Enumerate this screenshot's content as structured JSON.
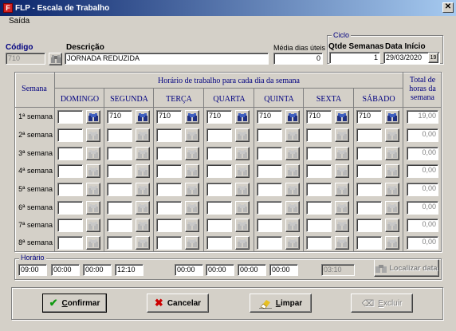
{
  "window": {
    "title": "FLP - Escala de Trabalho",
    "logo": "F",
    "close": "✕"
  },
  "menu": {
    "saida": "Saída"
  },
  "header": {
    "codigo_label": "Código",
    "codigo_value": "710",
    "descricao_label": "Descrição",
    "descricao_value": "JORNADA REDUZIDA",
    "media_label": "Média dias úteis",
    "media_value": "0",
    "ciclo_label": "Ciclo",
    "qtde_label": "Qtde Semanas",
    "qtde_value": "1",
    "data_label": "Data Início",
    "data_value": "29/03/2020",
    "calendar_glyph": "19"
  },
  "grid": {
    "semana_header": "Semana",
    "horario_header": "Horário de trabalho para cada dia da semana",
    "total_header": [
      "Total de",
      "horas da",
      "semana"
    ],
    "days": [
      "DOMINGO",
      "SEGUNDA",
      "TERÇA",
      "QUARTA",
      "QUINTA",
      "SEXTA",
      "SÁBADO"
    ],
    "rows": [
      {
        "label": "1ª semana",
        "values": [
          "",
          "710",
          "710",
          "710",
          "710",
          "710",
          "710"
        ],
        "total": "19,00"
      },
      {
        "label": "2ª semana",
        "values": [
          "",
          "",
          "",
          "",
          "",
          "",
          ""
        ],
        "total": "0,00"
      },
      {
        "label": "3ª semana",
        "values": [
          "",
          "",
          "",
          "",
          "",
          "",
          ""
        ],
        "total": "0,00"
      },
      {
        "label": "4ª semana",
        "values": [
          "",
          "",
          "",
          "",
          "",
          "",
          ""
        ],
        "total": "0,00"
      },
      {
        "label": "5ª semana",
        "values": [
          "",
          "",
          "",
          "",
          "",
          "",
          ""
        ],
        "total": "0,00"
      },
      {
        "label": "6ª semana",
        "values": [
          "",
          "",
          "",
          "",
          "",
          "",
          ""
        ],
        "total": "0,00"
      },
      {
        "label": "7ª semana",
        "values": [
          "",
          "",
          "",
          "",
          "",
          "",
          ""
        ],
        "total": "0,00"
      },
      {
        "label": "8ª semana",
        "values": [
          "",
          "",
          "",
          "",
          "",
          "",
          ""
        ],
        "total": "0,00"
      }
    ]
  },
  "horario": {
    "label": "Horário",
    "group1": [
      "09:00",
      "00:00",
      "00:00",
      "12:10"
    ],
    "group2": [
      "00:00",
      "00:00",
      "00:00",
      "00:00"
    ],
    "total": "03:10",
    "localizar_label": "Localizar data"
  },
  "buttons": {
    "confirmar": {
      "u": "C",
      "rest": "onfirmar"
    },
    "cancelar": "Cancelar",
    "limpar": {
      "u": "L",
      "rest": "impar"
    },
    "excluir": {
      "u": "E",
      "rest": "xcluir"
    }
  },
  "colors": {
    "face": "#d4d0c8",
    "title_start": "#0a246a",
    "title_end": "#a6caf0",
    "label_blue": "#000080",
    "confirm_green": "#119911",
    "cancel_red": "#cc0000"
  },
  "icons": {
    "binoculars": "binoculars-icon",
    "calendar": "calendar-icon",
    "check": "check-icon",
    "x": "x-icon",
    "eraser": "eraser-icon",
    "delete": "delete-icon"
  }
}
